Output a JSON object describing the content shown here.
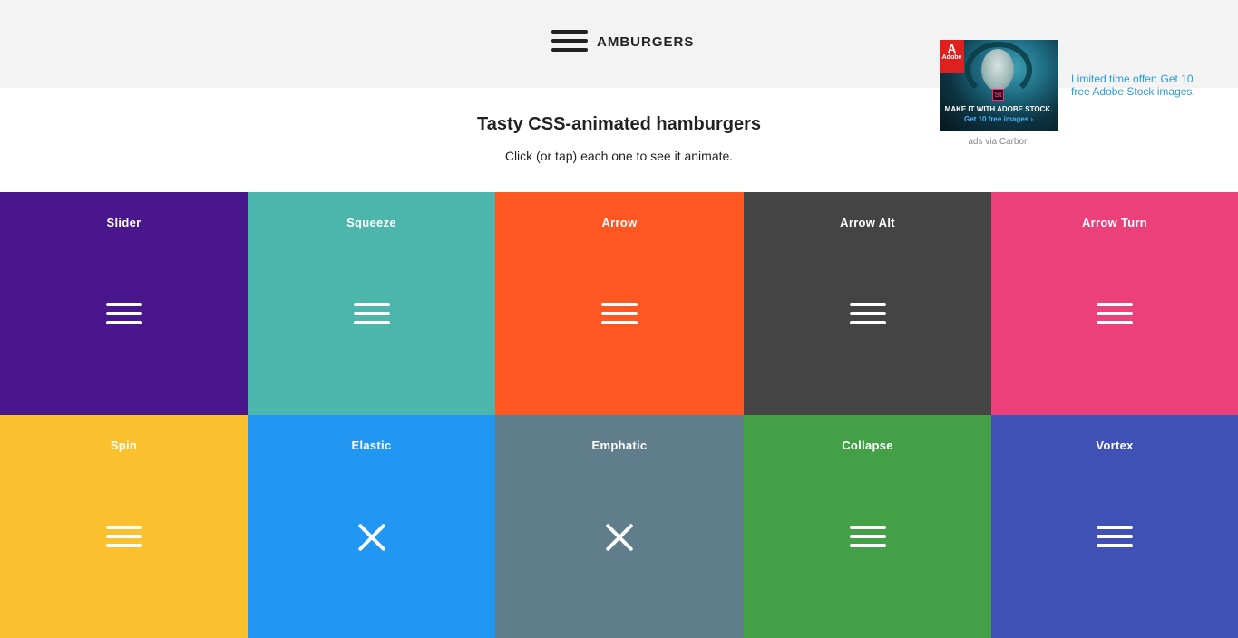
{
  "header": {
    "logo_text": "AMBURGERS"
  },
  "hero": {
    "title": "Tasty CSS-animated hamburgers",
    "subtitle": "Click (or tap) each one to see it animate."
  },
  "ad": {
    "badge_text": "Adobe",
    "product_mark": "St",
    "image_line1": "MAKE IT WITH ADOBE STOCK.",
    "image_line2": "Get 10 free images ›",
    "text": "Limited time offer: Get 10 free Adobe Stock images.",
    "via": "ads via Carbon"
  },
  "tiles": [
    {
      "label": "Slider",
      "color": "#4a168c",
      "state": "menu"
    },
    {
      "label": "Squeeze",
      "color": "#4db6ac",
      "state": "menu"
    },
    {
      "label": "Arrow",
      "color": "#ff5722",
      "state": "menu"
    },
    {
      "label": "Arrow Alt",
      "color": "#444444",
      "state": "menu"
    },
    {
      "label": "Arrow Turn",
      "color": "#ec407a",
      "state": "menu"
    },
    {
      "label": "Spin",
      "color": "#fbc02d",
      "state": "menu"
    },
    {
      "label": "Elastic",
      "color": "#2196f3",
      "state": "close"
    },
    {
      "label": "Emphatic",
      "color": "#607d8b",
      "state": "close"
    },
    {
      "label": "Collapse",
      "color": "#43a047",
      "state": "menu"
    },
    {
      "label": "Vortex",
      "color": "#3f51b5",
      "state": "menu"
    }
  ]
}
